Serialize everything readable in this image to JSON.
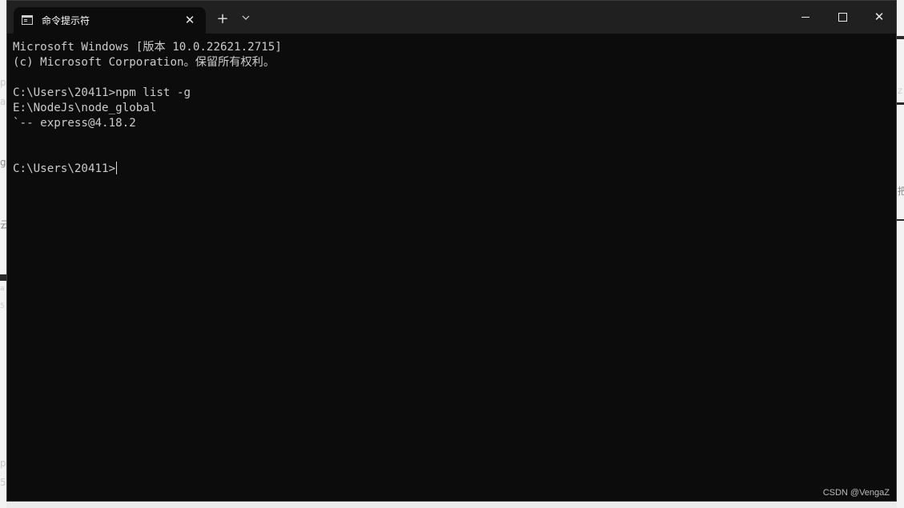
{
  "window": {
    "tab_title": "命令提示符",
    "tab_close": "✕",
    "new_tab": "+",
    "dropdown": "⌄",
    "close_glyph": "✕"
  },
  "console": {
    "lines": [
      "Microsoft Windows [版本 10.0.22621.2715]",
      "(c) Microsoft Corporation。保留所有权利。",
      "",
      "C:\\Users\\20411>npm list -g",
      "E:\\NodeJs\\node_global",
      "`-- express@4.18.2",
      "",
      "",
      "C:\\Users\\20411>"
    ]
  },
  "background": {
    "fragments": [
      "p",
      "a",
      "g",
      "云",
      "a",
      "5",
      "Z",
      "把",
      "p",
      "5"
    ]
  },
  "watermark": "CSDN @VengaZ",
  "icons": {
    "terminal": "terminal-app-icon",
    "minimize": "minimize-icon",
    "maximize": "maximize-icon",
    "close": "close-icon"
  },
  "colors": {
    "console_bg": "#0c0c0c",
    "titlebar_bg": "#202020",
    "console_text": "#cccccc"
  }
}
